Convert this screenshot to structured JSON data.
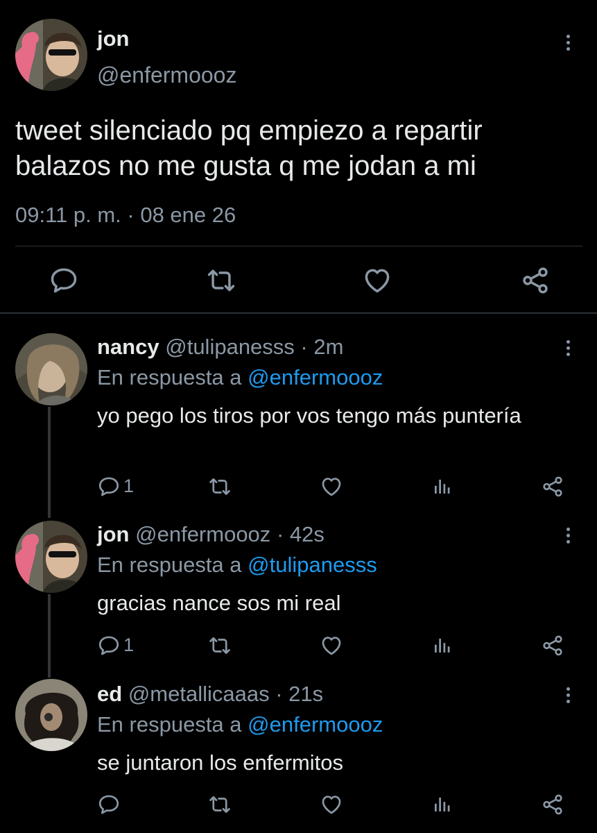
{
  "main_tweet": {
    "display_name": "jon",
    "handle": "@enfermoooz",
    "text": "tweet silenciado pq empiezo a repartir balazos no me gusta q me jodan a mi",
    "timestamp": "09:11 p. m. · 08 ene 26"
  },
  "replies": [
    {
      "display_name": "nancy",
      "handle": "@tulipanesss",
      "time": "· 2m",
      "reply_prefix": "En respuesta a",
      "reply_to": "@enfermoooz",
      "text": "yo pego los tiros por vos tengo más puntería",
      "reply_count": "1"
    },
    {
      "display_name": "jon",
      "handle": "@enfermoooz",
      "time": "· 42s",
      "reply_prefix": "En respuesta a",
      "reply_to": "@tulipanesss",
      "text": "gracias nance sos mi real",
      "reply_count": "1"
    },
    {
      "display_name": "ed",
      "handle": "@metallicaaas",
      "time": "· 21s",
      "reply_prefix": "En respuesta a",
      "reply_to": "@enfermoooz",
      "text": "se juntaron los enfermitos",
      "reply_count": ""
    }
  ],
  "icons": {
    "reply": "reply-icon",
    "retweet": "retweet-icon",
    "like": "heart-icon",
    "share": "share-icon",
    "views": "analytics-icon",
    "more": "more-vertical-icon"
  },
  "colors": {
    "background": "#000000",
    "text": "#e7e9ea",
    "secondary": "#8b98a5",
    "mention": "#1d9bf0",
    "divider": "#2f3336"
  }
}
